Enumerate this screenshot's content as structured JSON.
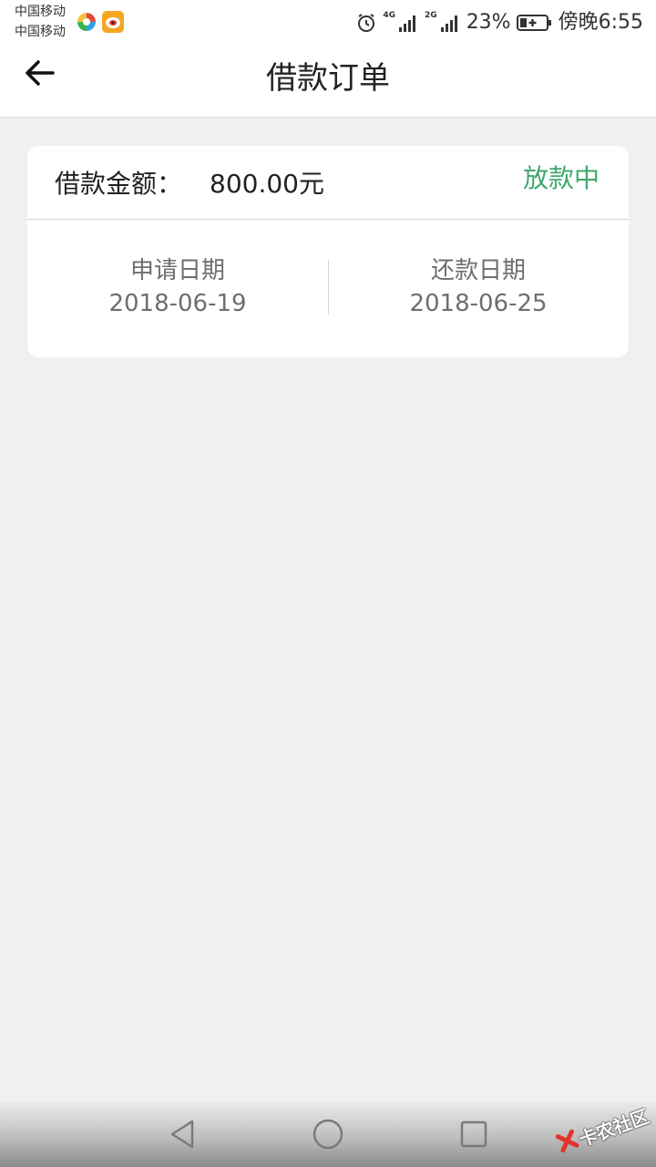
{
  "status_bar": {
    "carrier_1": "中国移动",
    "carrier_2": "中国移动",
    "net_type_1": "4G",
    "net_type_2": "2G",
    "battery": "23%",
    "time": "傍晚6:55",
    "icons": [
      "app-icon-colorful",
      "weibo-icon",
      "alarm-icon",
      "signal-icon",
      "signal-icon",
      "battery-charging-icon"
    ]
  },
  "header": {
    "title": "借款订单",
    "back_icon": "back-arrow-icon"
  },
  "order": {
    "amount_label": "借款金额：",
    "amount_value": "800.00元",
    "status": "放款中",
    "status_color": "#3fa86b",
    "apply_label": "申请日期",
    "apply_date": "2018-06-19",
    "repay_label": "还款日期",
    "repay_date": "2018-06-25"
  },
  "nav_bar": {
    "buttons": [
      "back-triangle-icon",
      "home-circle-icon",
      "recent-square-icon"
    ]
  },
  "watermark": {
    "text": "卡农社区"
  }
}
